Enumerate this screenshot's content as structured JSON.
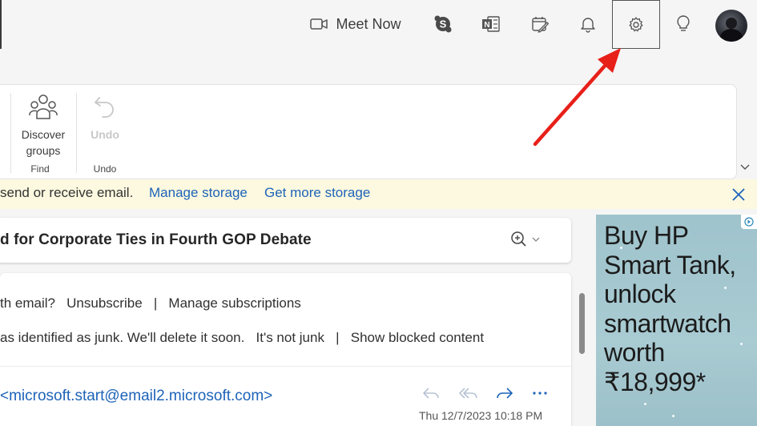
{
  "header": {
    "meet_now_label": "Meet Now",
    "icons": [
      "video-camera-icon",
      "skype-icon",
      "onenote-icon",
      "planner-icon",
      "bell-icon",
      "gear-icon",
      "lightbulb-icon"
    ]
  },
  "ribbon": {
    "groups": [
      {
        "name": "Find",
        "buttons": [
          {
            "label": "Discover groups",
            "icon": "people-group-icon"
          }
        ]
      },
      {
        "name": "Undo",
        "buttons": [
          {
            "label": "Undo",
            "icon": "undo-icon",
            "disabled": true
          }
        ]
      }
    ],
    "discover_label_line1": "Discover",
    "discover_label_line2": "groups",
    "find_group_label": "Find",
    "undo_label": "Undo",
    "undo_group_label": "Undo"
  },
  "banner": {
    "message": "send or receive email.",
    "manage_storage": "Manage storage",
    "get_more_storage": "Get more storage"
  },
  "email": {
    "subject": "d for Corporate Ties in Fourth GOP Debate",
    "unsubscribe_prompt": "th email?",
    "unsubscribe": "Unsubscribe",
    "separator": "|",
    "manage_subscriptions": "Manage subscriptions",
    "junk_notice": "as identified as junk. We'll delete it soon.",
    "not_junk": "It's not junk",
    "show_blocked": "Show blocked content",
    "sender": "<microsoft.start@email2.microsoft.com>",
    "date": "Thu 12/7/2023 10:18 PM"
  },
  "ad": {
    "line1": "Buy HP",
    "line2": "Smart Tank,",
    "line3": "unlock",
    "line4": "smartwatch",
    "line5": "worth",
    "line6": "₹18,999*"
  },
  "colors": {
    "accent_link": "#1d63b8",
    "banner_bg": "#fcf9e0",
    "annotation_arrow": "#e8201a"
  }
}
